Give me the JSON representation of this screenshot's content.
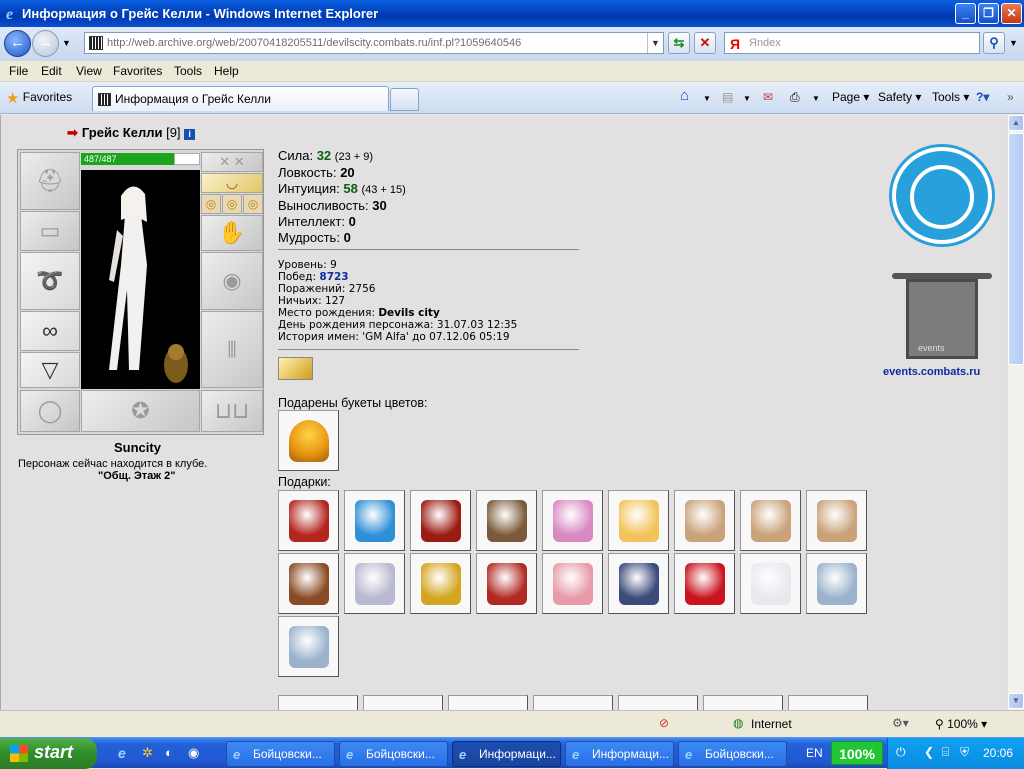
{
  "window": {
    "title": "Информация о Грейс Келли - Windows Internet Explorer"
  },
  "address": {
    "url": "http://web.archive.org/web/20070418205511/devilscity.combats.ru/inf.pl?1059640546",
    "search_placeholder": "Яndex",
    "search_brand": "Я"
  },
  "menu": [
    "File",
    "Edit",
    "View",
    "Favorites",
    "Tools",
    "Help"
  ],
  "tabs": {
    "favorites_label": "Favorites",
    "active_tab": "Информация о Грейс Келли"
  },
  "commands": [
    "Page",
    "Safety",
    "Tools"
  ],
  "character": {
    "name": "Грейс Келли",
    "level": "[9]",
    "hp": "487/487",
    "city": "Suncity",
    "location_text": "Персонаж сейчас находится в клубе.",
    "location_place": "\"Общ. Этаж 2\""
  },
  "stats": [
    {
      "label": "Сила:",
      "value": "32",
      "extra": "(23 + 9)",
      "boost": true
    },
    {
      "label": "Ловкость:",
      "value": "20",
      "extra": "",
      "boost": false
    },
    {
      "label": "Интуиция:",
      "value": "58",
      "extra": "(43 + 15)",
      "boost": true
    },
    {
      "label": "Выносливость:",
      "value": "30",
      "extra": "",
      "boost": false
    },
    {
      "label": "Интеллект:",
      "value": "0",
      "extra": "",
      "boost": false
    },
    {
      "label": "Мудрость:",
      "value": "0",
      "extra": "",
      "boost": false
    }
  ],
  "details": {
    "level": "Уровень: 9",
    "wins_label": "Побед: ",
    "wins": "8723",
    "losses": "Поражений: 2756",
    "draws": "Ничьих: 127",
    "birthplace_label": "Место рождения: ",
    "birthplace": "Devils city",
    "birthday": "День рождения персонажа: 31.07.03 12:35",
    "names_history": "История имен: 'GM Alfa' до 07.12.06 05:19"
  },
  "sections": {
    "bouquets": "Подарены букеты цветов:",
    "gifts": "Подарки:"
  },
  "gifts": [
    {
      "name": "gift-box-icon",
      "color": "#b3261e"
    },
    {
      "name": "blue-bag-icon",
      "color": "#2f8fd6"
    },
    {
      "name": "red-candy-icon",
      "color": "#9b1b12"
    },
    {
      "name": "knight-figure-icon",
      "color": "#7a5a3a"
    },
    {
      "name": "doll-icon",
      "color": "#d889c2"
    },
    {
      "name": "candle-icon",
      "color": "#f2c35a"
    },
    {
      "name": "teddy-bear-icon",
      "color": "#c9a27a"
    },
    {
      "name": "teddy-bear-icon",
      "color": "#c9a27a"
    },
    {
      "name": "teddy-bear-icon",
      "color": "#c9a27a"
    },
    {
      "name": "rolling-pin-icon",
      "color": "#8a4b24"
    },
    {
      "name": "snowflake-icon",
      "color": "#b8b8d0"
    },
    {
      "name": "gold-star-icon",
      "color": "#d4a520"
    },
    {
      "name": "santa-icon",
      "color": "#b02a24"
    },
    {
      "name": "pig-icon",
      "color": "#e89aa8"
    },
    {
      "name": "chocolate-box-icon",
      "color": "#3a4a7a"
    },
    {
      "name": "balloon-2007-icon",
      "color": "#c8141e"
    },
    {
      "name": "white-cat-icon",
      "color": "#e8e8ee"
    },
    {
      "name": "ice-figure-icon",
      "color": "#9ab2cc"
    },
    {
      "name": "ice-figure-icon",
      "color": "#9ab2cc"
    }
  ],
  "emblems": {
    "events_link": "events.combats.ru",
    "events_label": "events"
  },
  "statusbar": {
    "zone": "Internet",
    "zoom": "100%"
  },
  "taskbar": {
    "start": "start",
    "tasks": [
      {
        "label": "Бойцовски...",
        "active": false
      },
      {
        "label": "Бойцовски...",
        "active": false
      },
      {
        "label": "Информаци...",
        "active": true
      },
      {
        "label": "Информаци...",
        "active": false
      },
      {
        "label": "Бойцовски...",
        "active": false
      }
    ],
    "lang": "EN",
    "zoom_badge": "100%",
    "clock": "20:06"
  }
}
